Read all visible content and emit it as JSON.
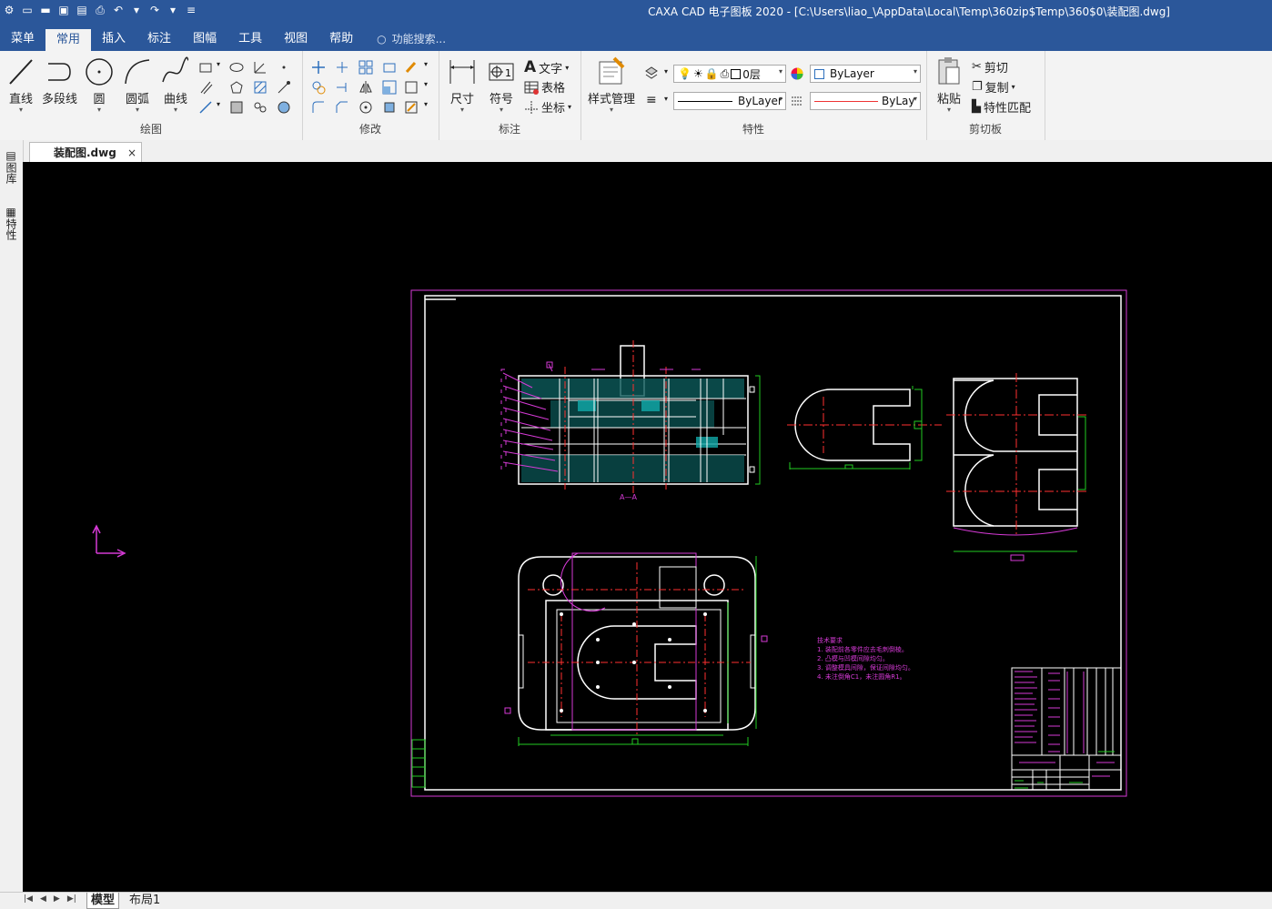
{
  "window": {
    "title": "CAXA CAD 电子图板 2020 - [C:\\Users\\liao_\\AppData\\Local\\Temp\\360zip$Temp\\360$0\\装配图.dwg]"
  },
  "menu": {
    "tabs": [
      "菜单",
      "常用",
      "插入",
      "标注",
      "图幅",
      "工具",
      "视图",
      "帮助"
    ],
    "active": "常用",
    "search_placeholder": "功能搜索..."
  },
  "ribbon": {
    "draw": {
      "label": "绘图",
      "line": "直线",
      "polyline": "多段线",
      "circle": "圆",
      "arc": "圆弧",
      "curve": "曲线"
    },
    "modify": {
      "label": "修改"
    },
    "annotate": {
      "label": "标注",
      "dimension": "尺寸",
      "symbol": "符号",
      "text": "文字",
      "table": "表格",
      "coordinate": "坐标"
    },
    "properties": {
      "label": "特性",
      "style_manager": "样式管理",
      "layer": "0层",
      "color": "ByLayer",
      "linetype": "ByLayer",
      "lineweight": "ByLay"
    },
    "clipboard": {
      "label": "剪切板",
      "paste": "粘贴",
      "cut": "剪切",
      "copy": "复制",
      "match": "特性匹配"
    }
  },
  "document": {
    "tab": "装配图.dwg"
  },
  "sidebar": {
    "library": "图库",
    "properties": "特性"
  },
  "drawing": {
    "section_label": "A—A",
    "notes": [
      "技术要求",
      "1. 装配前各零件应去毛刺倒棱。",
      "2. 凸模与凹模间隙均匀。",
      "3. 调整模具间隙，保证间隙均匀。",
      "4. 未注倒角C1，未注圆角R1。"
    ]
  },
  "status": {
    "layouts": [
      "模型",
      "布局1"
    ],
    "active_layout": "模型"
  },
  "colors": {
    "accent": "#2b579a",
    "canvas": "#000000",
    "outline": "#ffffff",
    "magenta": "#d63ad6",
    "green": "#22cc22",
    "red": "#ff3030"
  }
}
